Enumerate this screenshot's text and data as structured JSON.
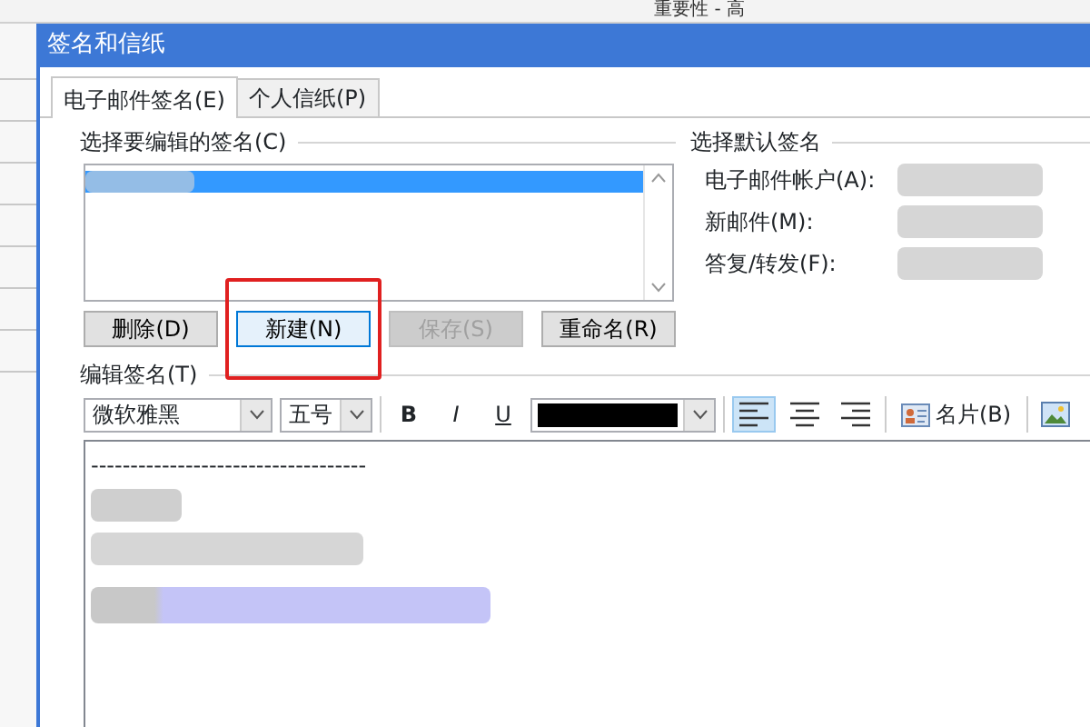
{
  "ribbon": {
    "text": "重要性 - 高"
  },
  "dialog": {
    "title": "签名和信纸"
  },
  "tabs": [
    {
      "label": "电子邮件签名(E)",
      "selected": true
    },
    {
      "label": "个人信纸(P)",
      "selected": false
    }
  ],
  "signature_list": {
    "heading": "选择要编辑的签名(C)",
    "items": [
      {
        "selected": true
      }
    ]
  },
  "buttons": [
    {
      "label": "删除(D)",
      "disabled": false,
      "focused": false,
      "highlighted": false
    },
    {
      "label": "新建(N)",
      "disabled": false,
      "focused": true,
      "highlighted": true
    },
    {
      "label": "保存(S)",
      "disabled": true,
      "focused": false,
      "highlighted": false
    },
    {
      "label": "重命名(R)",
      "disabled": false,
      "focused": false,
      "highlighted": false
    }
  ],
  "default_signature": {
    "heading": "选择默认签名",
    "fields": [
      {
        "label": "电子邮件帐户(A):"
      },
      {
        "label": "新邮件(M):"
      },
      {
        "label": "答复/转发(F):"
      }
    ]
  },
  "editor": {
    "heading": "编辑签名(T)",
    "font": "微软雅黑",
    "size": "五号",
    "format_buttons": [
      "B",
      "I",
      "U"
    ],
    "alignments": [
      {
        "selected": true
      },
      {
        "selected": false
      },
      {
        "selected": false
      }
    ],
    "card_button": "名片(B)",
    "separator_line": "-----------------------------------"
  }
}
